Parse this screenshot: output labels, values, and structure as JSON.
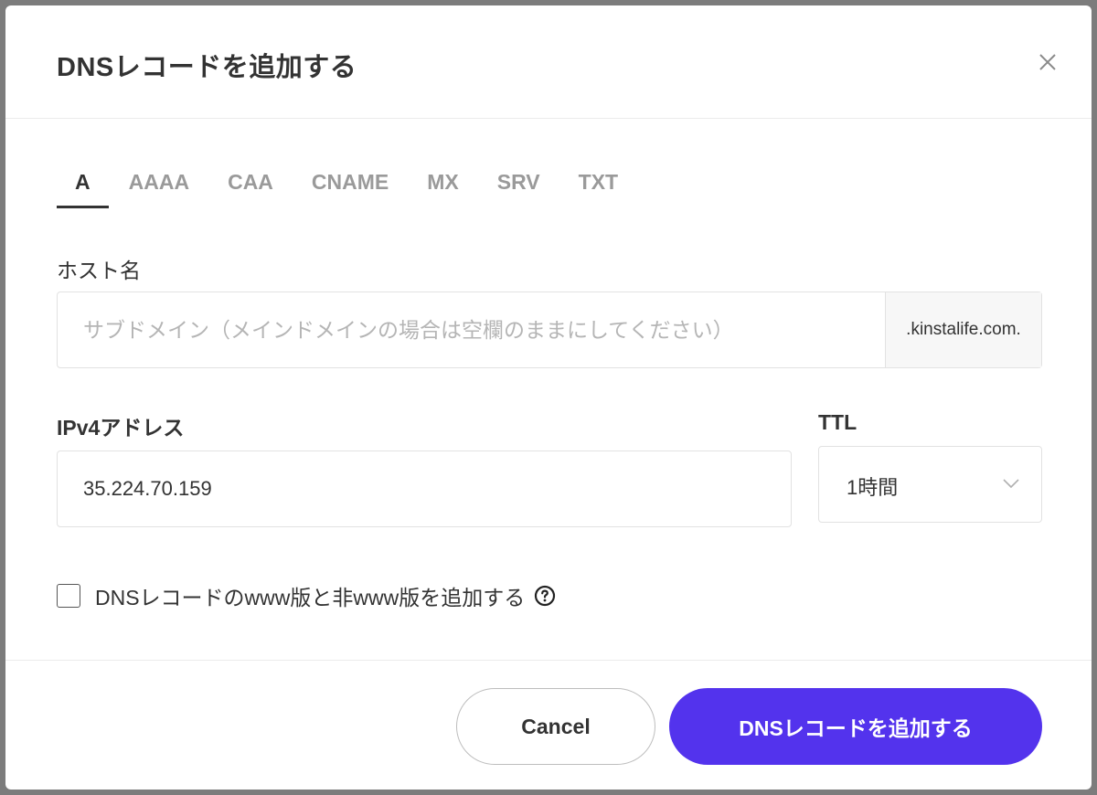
{
  "dialog": {
    "title": "DNSレコードを追加する"
  },
  "tabs": [
    {
      "label": "A",
      "active": true
    },
    {
      "label": "AAAA",
      "active": false
    },
    {
      "label": "CAA",
      "active": false
    },
    {
      "label": "CNAME",
      "active": false
    },
    {
      "label": "MX",
      "active": false
    },
    {
      "label": "SRV",
      "active": false
    },
    {
      "label": "TXT",
      "active": false
    }
  ],
  "hostname": {
    "label": "ホスト名",
    "value": "",
    "placeholder": "サブドメイン（メインドメインの場合は空欄のままにしてください）",
    "suffix": ".kinstalife.com."
  },
  "ipv4": {
    "label": "IPv4アドレス",
    "value": "35.224.70.159"
  },
  "ttl": {
    "label": "TTL",
    "selected": "1時間"
  },
  "www_option": {
    "label": "DNSレコードのwww版と非www版を追加する",
    "checked": false
  },
  "footer": {
    "cancel_label": "Cancel",
    "submit_label": "DNSレコードを追加する"
  },
  "colors": {
    "primary": "#5333ed",
    "text": "#333333",
    "muted": "#9a9a9a",
    "border": "#e2e2e2"
  },
  "icons": {
    "close": "close-icon",
    "ttl_dropdown": "chevron-down-icon",
    "help": "question-circle-icon"
  }
}
